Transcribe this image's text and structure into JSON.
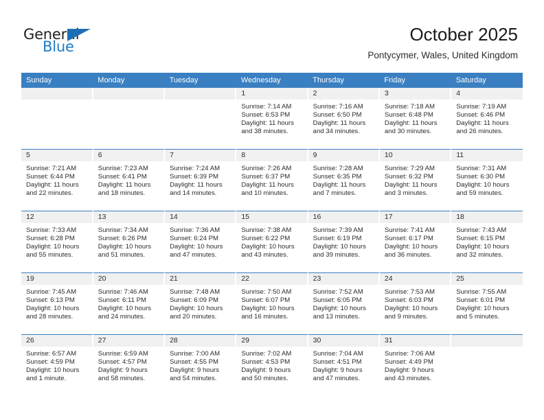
{
  "brand": {
    "word_one": "General",
    "word_two": "Blue",
    "triangle_icon": "triangle-icon",
    "accent_color": "#1c6fb5"
  },
  "header": {
    "title": "October 2025",
    "location": "Pontycymer, Wales, United Kingdom"
  },
  "theme": {
    "header_blue": "#3a7fc1",
    "daynum_band": "#f0f0f0",
    "text": "#2b2b2b"
  },
  "calendar": {
    "weekday_headers": [
      "Sunday",
      "Monday",
      "Tuesday",
      "Wednesday",
      "Thursday",
      "Friday",
      "Saturday"
    ],
    "labels": {
      "sunrise_prefix": "Sunrise:",
      "sunset_prefix": "Sunset:",
      "daylight_prefix": "Daylight:"
    },
    "weeks": [
      [
        {
          "day": "",
          "empty": true
        },
        {
          "day": "",
          "empty": true
        },
        {
          "day": "",
          "empty": true
        },
        {
          "day": "1",
          "sunrise": "Sunrise: 7:14 AM",
          "sunset": "Sunset: 6:53 PM",
          "daylight_line1": "Daylight: 11 hours",
          "daylight_line2": "and 38 minutes."
        },
        {
          "day": "2",
          "sunrise": "Sunrise: 7:16 AM",
          "sunset": "Sunset: 6:50 PM",
          "daylight_line1": "Daylight: 11 hours",
          "daylight_line2": "and 34 minutes."
        },
        {
          "day": "3",
          "sunrise": "Sunrise: 7:18 AM",
          "sunset": "Sunset: 6:48 PM",
          "daylight_line1": "Daylight: 11 hours",
          "daylight_line2": "and 30 minutes."
        },
        {
          "day": "4",
          "sunrise": "Sunrise: 7:19 AM",
          "sunset": "Sunset: 6:46 PM",
          "daylight_line1": "Daylight: 11 hours",
          "daylight_line2": "and 26 minutes."
        }
      ],
      [
        {
          "day": "5",
          "sunrise": "Sunrise: 7:21 AM",
          "sunset": "Sunset: 6:44 PM",
          "daylight_line1": "Daylight: 11 hours",
          "daylight_line2": "and 22 minutes."
        },
        {
          "day": "6",
          "sunrise": "Sunrise: 7:23 AM",
          "sunset": "Sunset: 6:41 PM",
          "daylight_line1": "Daylight: 11 hours",
          "daylight_line2": "and 18 minutes."
        },
        {
          "day": "7",
          "sunrise": "Sunrise: 7:24 AM",
          "sunset": "Sunset: 6:39 PM",
          "daylight_line1": "Daylight: 11 hours",
          "daylight_line2": "and 14 minutes."
        },
        {
          "day": "8",
          "sunrise": "Sunrise: 7:26 AM",
          "sunset": "Sunset: 6:37 PM",
          "daylight_line1": "Daylight: 11 hours",
          "daylight_line2": "and 10 minutes."
        },
        {
          "day": "9",
          "sunrise": "Sunrise: 7:28 AM",
          "sunset": "Sunset: 6:35 PM",
          "daylight_line1": "Daylight: 11 hours",
          "daylight_line2": "and 7 minutes."
        },
        {
          "day": "10",
          "sunrise": "Sunrise: 7:29 AM",
          "sunset": "Sunset: 6:32 PM",
          "daylight_line1": "Daylight: 11 hours",
          "daylight_line2": "and 3 minutes."
        },
        {
          "day": "11",
          "sunrise": "Sunrise: 7:31 AM",
          "sunset": "Sunset: 6:30 PM",
          "daylight_line1": "Daylight: 10 hours",
          "daylight_line2": "and 59 minutes."
        }
      ],
      [
        {
          "day": "12",
          "sunrise": "Sunrise: 7:33 AM",
          "sunset": "Sunset: 6:28 PM",
          "daylight_line1": "Daylight: 10 hours",
          "daylight_line2": "and 55 minutes."
        },
        {
          "day": "13",
          "sunrise": "Sunrise: 7:34 AM",
          "sunset": "Sunset: 6:26 PM",
          "daylight_line1": "Daylight: 10 hours",
          "daylight_line2": "and 51 minutes."
        },
        {
          "day": "14",
          "sunrise": "Sunrise: 7:36 AM",
          "sunset": "Sunset: 6:24 PM",
          "daylight_line1": "Daylight: 10 hours",
          "daylight_line2": "and 47 minutes."
        },
        {
          "day": "15",
          "sunrise": "Sunrise: 7:38 AM",
          "sunset": "Sunset: 6:22 PM",
          "daylight_line1": "Daylight: 10 hours",
          "daylight_line2": "and 43 minutes."
        },
        {
          "day": "16",
          "sunrise": "Sunrise: 7:39 AM",
          "sunset": "Sunset: 6:19 PM",
          "daylight_line1": "Daylight: 10 hours",
          "daylight_line2": "and 39 minutes."
        },
        {
          "day": "17",
          "sunrise": "Sunrise: 7:41 AM",
          "sunset": "Sunset: 6:17 PM",
          "daylight_line1": "Daylight: 10 hours",
          "daylight_line2": "and 36 minutes."
        },
        {
          "day": "18",
          "sunrise": "Sunrise: 7:43 AM",
          "sunset": "Sunset: 6:15 PM",
          "daylight_line1": "Daylight: 10 hours",
          "daylight_line2": "and 32 minutes."
        }
      ],
      [
        {
          "day": "19",
          "sunrise": "Sunrise: 7:45 AM",
          "sunset": "Sunset: 6:13 PM",
          "daylight_line1": "Daylight: 10 hours",
          "daylight_line2": "and 28 minutes."
        },
        {
          "day": "20",
          "sunrise": "Sunrise: 7:46 AM",
          "sunset": "Sunset: 6:11 PM",
          "daylight_line1": "Daylight: 10 hours",
          "daylight_line2": "and 24 minutes."
        },
        {
          "day": "21",
          "sunrise": "Sunrise: 7:48 AM",
          "sunset": "Sunset: 6:09 PM",
          "daylight_line1": "Daylight: 10 hours",
          "daylight_line2": "and 20 minutes."
        },
        {
          "day": "22",
          "sunrise": "Sunrise: 7:50 AM",
          "sunset": "Sunset: 6:07 PM",
          "daylight_line1": "Daylight: 10 hours",
          "daylight_line2": "and 16 minutes."
        },
        {
          "day": "23",
          "sunrise": "Sunrise: 7:52 AM",
          "sunset": "Sunset: 6:05 PM",
          "daylight_line1": "Daylight: 10 hours",
          "daylight_line2": "and 13 minutes."
        },
        {
          "day": "24",
          "sunrise": "Sunrise: 7:53 AM",
          "sunset": "Sunset: 6:03 PM",
          "daylight_line1": "Daylight: 10 hours",
          "daylight_line2": "and 9 minutes."
        },
        {
          "day": "25",
          "sunrise": "Sunrise: 7:55 AM",
          "sunset": "Sunset: 6:01 PM",
          "daylight_line1": "Daylight: 10 hours",
          "daylight_line2": "and 5 minutes."
        }
      ],
      [
        {
          "day": "26",
          "sunrise": "Sunrise: 6:57 AM",
          "sunset": "Sunset: 4:59 PM",
          "daylight_line1": "Daylight: 10 hours",
          "daylight_line2": "and 1 minute."
        },
        {
          "day": "27",
          "sunrise": "Sunrise: 6:59 AM",
          "sunset": "Sunset: 4:57 PM",
          "daylight_line1": "Daylight: 9 hours",
          "daylight_line2": "and 58 minutes."
        },
        {
          "day": "28",
          "sunrise": "Sunrise: 7:00 AM",
          "sunset": "Sunset: 4:55 PM",
          "daylight_line1": "Daylight: 9 hours",
          "daylight_line2": "and 54 minutes."
        },
        {
          "day": "29",
          "sunrise": "Sunrise: 7:02 AM",
          "sunset": "Sunset: 4:53 PM",
          "daylight_line1": "Daylight: 9 hours",
          "daylight_line2": "and 50 minutes."
        },
        {
          "day": "30",
          "sunrise": "Sunrise: 7:04 AM",
          "sunset": "Sunset: 4:51 PM",
          "daylight_line1": "Daylight: 9 hours",
          "daylight_line2": "and 47 minutes."
        },
        {
          "day": "31",
          "sunrise": "Sunrise: 7:06 AM",
          "sunset": "Sunset: 4:49 PM",
          "daylight_line1": "Daylight: 9 hours",
          "daylight_line2": "and 43 minutes."
        },
        {
          "day": "",
          "empty": true
        }
      ]
    ]
  }
}
